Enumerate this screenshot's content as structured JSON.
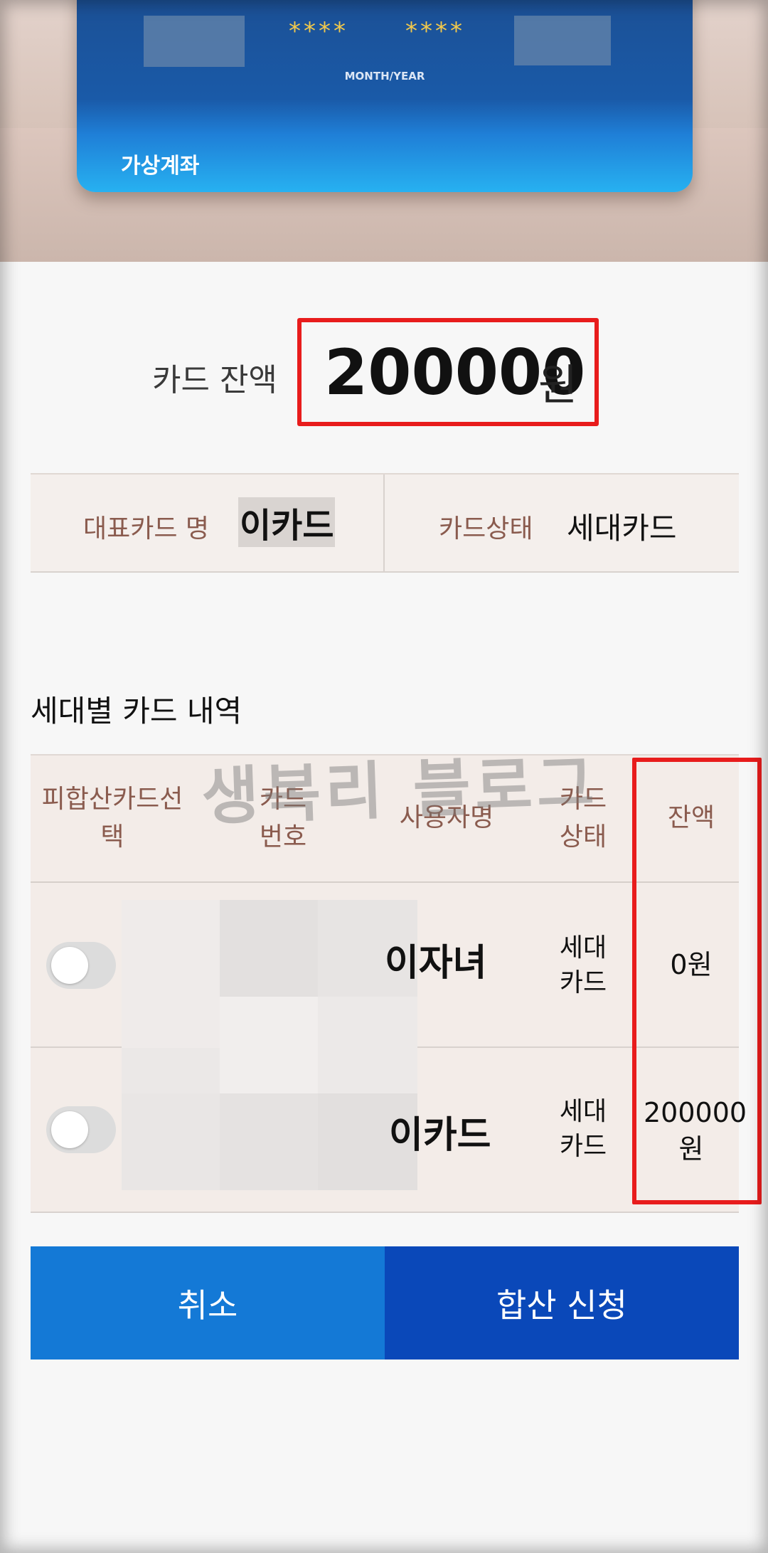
{
  "card": {
    "stars_left": "****",
    "stars_right": "****",
    "expiry_label": "MONTH/YEAR",
    "account_label": "가상계좌"
  },
  "balance": {
    "label": "카드 잔액",
    "amount": "200000",
    "unit": "원"
  },
  "info": {
    "card_name_label": "대표카드 명",
    "card_name_value": "이카드",
    "card_status_label": "카드상태",
    "card_status_value": "세대카드"
  },
  "section": {
    "title": "세대별 카드 내역"
  },
  "table": {
    "headers": {
      "select": "피합산카드선\n택",
      "card_number": "카드\n번호",
      "user_name": "사용자명",
      "status": "카드\n상태",
      "balance": "잔액"
    },
    "rows": [
      {
        "user_name": "이자녀",
        "status": "세대\n카드",
        "balance": "0원"
      },
      {
        "user_name": "이카드",
        "status": "세대\n카드",
        "balance": "200000\n원"
      }
    ]
  },
  "watermark": "생복리 블로그",
  "buttons": {
    "cancel": "취소",
    "apply": "합산 신청"
  },
  "colors": {
    "primary_blue": "#1479d6",
    "dark_blue": "#0a48b9",
    "highlight_red": "#e81c1c",
    "label_brown": "#8a5b4e"
  }
}
